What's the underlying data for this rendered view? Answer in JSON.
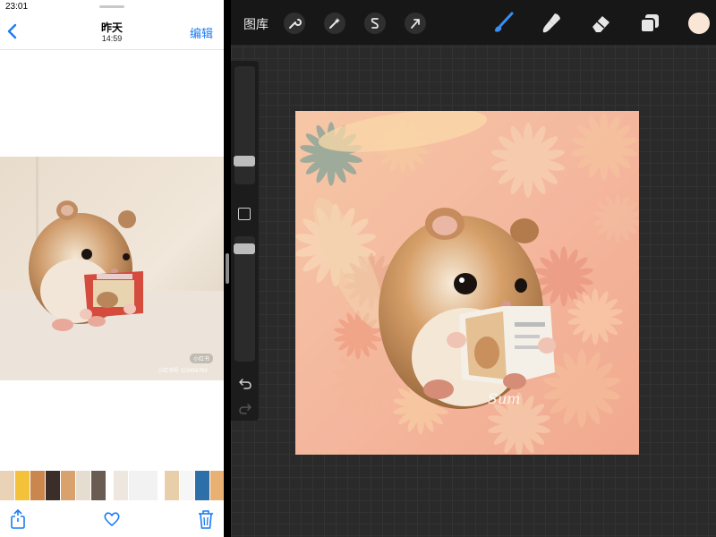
{
  "status_bar": {
    "time": "23:01"
  },
  "photos": {
    "nav": {
      "title": "昨天",
      "subtitle": "14:59",
      "edit_label": "编辑",
      "back_icon": "chevron-left-icon"
    },
    "photo_watermark": {
      "badge": "小红书",
      "text": "小红书号 123456789"
    },
    "filmstrip_count": 16,
    "toolbar": {
      "share_icon": "share-icon",
      "favorite_icon": "heart-icon",
      "delete_icon": "trash-icon"
    },
    "accent_color": "#1a7cf5"
  },
  "procreate": {
    "gallery_label": "图库",
    "tools_left": [
      "wrench-icon",
      "magic-wand-icon",
      "selection-icon",
      "transform-arrow-icon"
    ],
    "tools_right": [
      "brush-icon",
      "smudge-icon",
      "eraser-icon",
      "layers-icon"
    ],
    "active_tool": "brush-icon",
    "active_color": "#f9e6d6",
    "accent_color": "#3b8ef0"
  },
  "artwork": {
    "signature": "Sum"
  }
}
